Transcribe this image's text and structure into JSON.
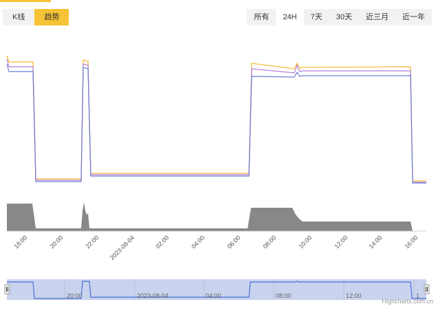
{
  "tabs": [
    {
      "label": "K线",
      "active": false
    },
    {
      "label": "趋势",
      "active": true
    }
  ],
  "ranges": [
    {
      "label": "所有",
      "active": false
    },
    {
      "label": "24H",
      "active": true
    },
    {
      "label": "7天",
      "active": false
    },
    {
      "label": "30天",
      "active": false
    },
    {
      "label": "近三月",
      "active": false
    },
    {
      "label": "近一年",
      "active": false
    }
  ],
  "colors": {
    "accent": "#f5c333",
    "series_orange": "#f7b733",
    "series_purple": "#b57bd8",
    "series_blue": "#6c7fd6",
    "volume": "#888888",
    "navigator_fill": "#c9d3ee",
    "navigator_line": "#4a6fd8"
  },
  "chart_data": {
    "type": "line",
    "xlabel": "",
    "ylabel": "",
    "x_ticks": [
      "18:00",
      "20:00",
      "22:00",
      "2023-08-04",
      "02:00",
      "04:00",
      "06:00",
      "08:00",
      "10:00",
      "12:00",
      "14:00",
      "16:00"
    ],
    "series": [
      {
        "color": "#f7b733"
      },
      {
        "color": "#b57bd8"
      },
      {
        "color": "#6c7fd6"
      }
    ],
    "volume": {
      "color": "#888888"
    },
    "navigator": {
      "labels": [
        "20:00",
        "2023-08-04",
        "04:00",
        "08:00",
        "12:00",
        "1"
      ]
    }
  },
  "credit": "Highcharts.com.cn"
}
